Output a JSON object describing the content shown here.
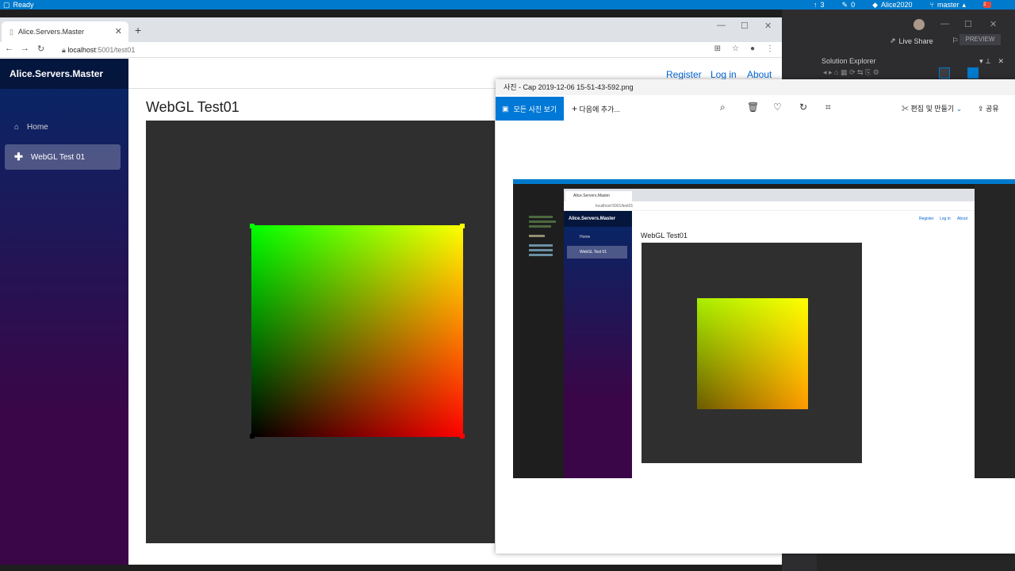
{
  "vs_status": {
    "ready": "Ready",
    "up_count": "3",
    "pencil_count": "0",
    "repo": "Alice2020",
    "branch": "master",
    "notifications": "2"
  },
  "vs_toolbar": {
    "live_share": "Live Share",
    "preview": "PREVIEW",
    "solution_explorer": "Solution Explorer"
  },
  "browser": {
    "tab_title": "Alice.Servers.Master",
    "url_host": "localhost",
    "url_port_path": ":5001/test01"
  },
  "page": {
    "brand": "Alice.Servers.Master",
    "nav": [
      {
        "label": "Home"
      },
      {
        "label": "WebGL Test 01"
      }
    ],
    "top_links": [
      "Register",
      "Log in",
      "About"
    ],
    "title": "WebGL Test01"
  },
  "photos": {
    "window_title": "사진 - Cap 2019-12-06 15-51-43-592.png",
    "all_photos": "모든 사진 보기",
    "add_to": "다음에 추가...",
    "edit_create": "편집 및 만들기",
    "share": "공유"
  },
  "shot": {
    "tab_title": "Alice.Servers.Master",
    "url": "localhost:5001/test01",
    "brand": "Alice.Servers.Master",
    "nav": [
      "Home",
      "WebGL Test 01"
    ],
    "links": [
      "Register",
      "Log in",
      "About"
    ],
    "title": "WebGL Test01"
  },
  "colors": {
    "vs_blue": "#007acc",
    "chrome_tab_bg": "#dee1e6",
    "sidebar_top": "#052767",
    "sidebar_bottom": "#3a0647",
    "link_blue": "#0366d6",
    "photos_accent": "#0078d7",
    "canvas_bg": "#2f2f2f"
  }
}
